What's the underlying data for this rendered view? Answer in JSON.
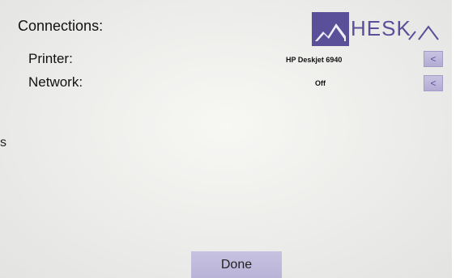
{
  "edge_text": "s",
  "header": {
    "title": "Connections:",
    "logo_text": "HESK"
  },
  "connections": {
    "printer": {
      "label": "Printer:",
      "value": "HP Deskjet 6940",
      "button_label": "<"
    },
    "network": {
      "label": "Network:",
      "value": "Off",
      "button_label": "<"
    }
  },
  "footer": {
    "done_label": "Done"
  },
  "colors": {
    "accent": "#5a4f99",
    "button": "#bdb7da"
  }
}
